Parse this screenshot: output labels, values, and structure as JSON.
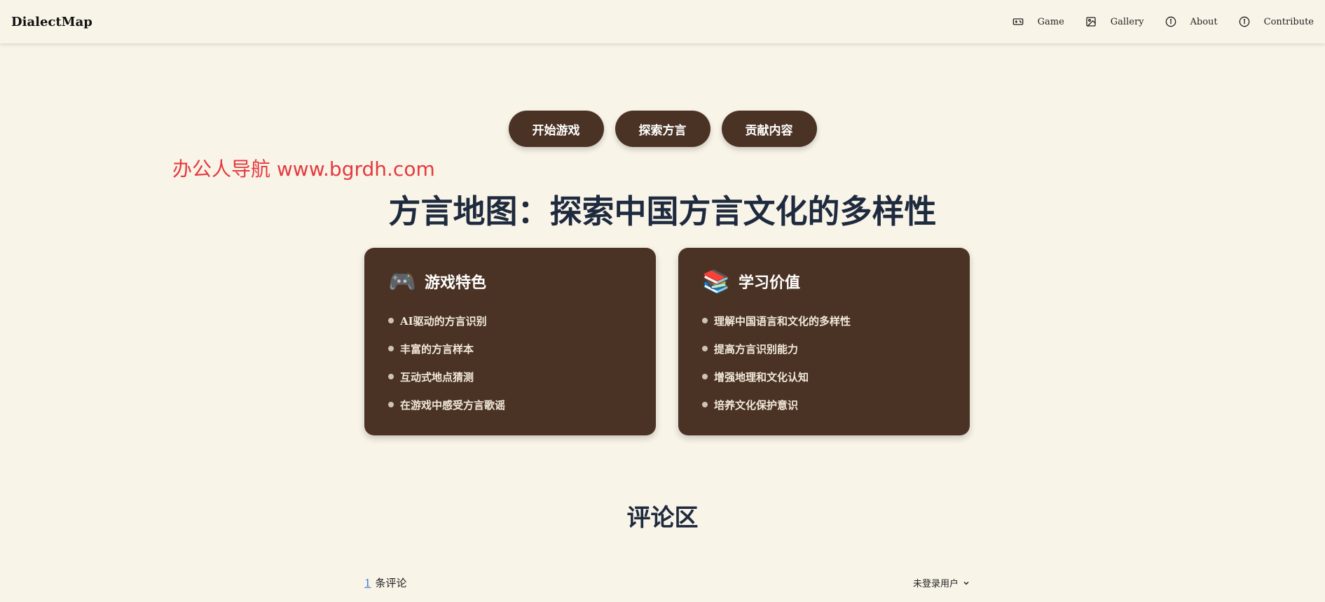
{
  "brand": "DialectMap",
  "nav": [
    {
      "label": "Game",
      "icon": "gamepad-icon"
    },
    {
      "label": "Gallery",
      "icon": "image-icon"
    },
    {
      "label": "About",
      "icon": "info-icon"
    },
    {
      "label": "Contribute",
      "icon": "info-icon"
    }
  ],
  "actions": {
    "start": "开始游戏",
    "explore": "探索方言",
    "contribute": "贡献内容"
  },
  "watermark": "办公人导航 www.bgrdh.com",
  "title": "方言地图：探索中国方言文化的多样性",
  "cards": {
    "features": {
      "icon": "🎮",
      "title": "游戏特色",
      "items": [
        "AI驱动的方言识别",
        "丰富的方言样本",
        "互动式地点猜测",
        "在游戏中感受方言歌谣"
      ]
    },
    "value": {
      "icon": "📚",
      "title": "学习价值",
      "items": [
        "理解中国语言和文化的多样性",
        "提高方言识别能力",
        "增强地理和文化认知",
        "培养文化保护意识"
      ]
    }
  },
  "comments": {
    "title": "评论区",
    "count": "1",
    "count_label": "条评论",
    "user": "未登录用户"
  },
  "colors": {
    "background": "#f9f4e8",
    "button": "#4a3324",
    "card": "#4a3324",
    "title": "#1e2a3e",
    "watermark": "#e5393f",
    "link": "#3b7ad9"
  }
}
